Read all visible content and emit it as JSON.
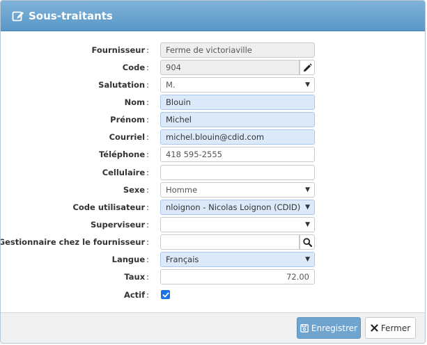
{
  "dialog": {
    "title": "Sous-traitants",
    "title_icon": "edit-icon"
  },
  "colors": {
    "header": "#6ba5d2",
    "highlight_field": "#dbe9f9",
    "save_button": "#6fa4cf",
    "checkbox": "#1a73e8"
  },
  "fields": {
    "fournisseur": {
      "label": "Fournisseur",
      "value": "Ferme de victoriaville"
    },
    "code": {
      "label": "Code",
      "value": "904",
      "button_icon": "pencil-icon"
    },
    "salutation": {
      "label": "Salutation",
      "value": "M."
    },
    "nom": {
      "label": "Nom",
      "value": "Blouin"
    },
    "prenom": {
      "label": "Prénom",
      "value": "Michel"
    },
    "courriel": {
      "label": "Courriel",
      "value": "michel.blouin@cdid.com"
    },
    "telephone": {
      "label": "Téléphone",
      "value": "418 595-2555"
    },
    "cellulaire": {
      "label": "Cellulaire",
      "value": ""
    },
    "sexe": {
      "label": "Sexe",
      "value": "Homme"
    },
    "code_utilisateur": {
      "label": "Code utilisateur",
      "value": "nloignon - Nicolas Loignon (CDID)"
    },
    "superviseur": {
      "label": "Superviseur",
      "value": ""
    },
    "gestionnaire": {
      "label": "Gestionnaire chez le fournisseur",
      "value": "",
      "button_icon": "search-icon"
    },
    "langue": {
      "label": "Langue",
      "value": "Français"
    },
    "taux": {
      "label": "Taux",
      "value": "72.00"
    },
    "actif": {
      "label": "Actif",
      "checked": true
    }
  },
  "colon": ":",
  "footer": {
    "save_label": "Enregistrer",
    "close_label": "Fermer"
  }
}
